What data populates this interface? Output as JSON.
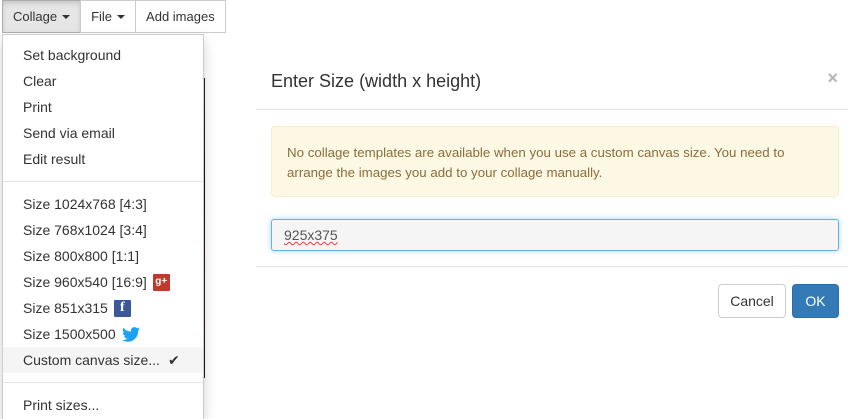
{
  "toolbar": {
    "collage_label": "Collage",
    "file_label": "File",
    "add_images_label": "Add images"
  },
  "menu": {
    "group1": [
      "Set background",
      "Clear",
      "Print",
      "Send via email",
      "Edit result"
    ],
    "sizes": {
      "s1": "Size 1024x768 [4:3]",
      "s2": "Size 768x1024 [3:4]",
      "s3": "Size 800x800 [1:1]",
      "s4": "Size 960x540 [16:9]",
      "s5": "Size 851x315",
      "s6": "Size 1500x500",
      "custom": "Custom canvas size..."
    },
    "print_sizes": "Print sizes...",
    "gplus_glyph": "g+",
    "fb_glyph": "f",
    "check_glyph": "✔"
  },
  "modal": {
    "title": "Enter Size",
    "title_suffix": "(width x height)",
    "close_glyph": "×",
    "alert_text": "No collage templates are available when you use a custom canvas size. You need to arrange the images you add to your collage manually.",
    "input_value": "925x375",
    "cancel_label": "Cancel",
    "ok_label": "OK"
  },
  "colors": {
    "primary": "#337ab7",
    "warning_bg": "#fcf8e3",
    "warning_text": "#8a6d3b",
    "gplus": "#c0392b",
    "facebook": "#3b5998",
    "twitter": "#1da1f2"
  }
}
